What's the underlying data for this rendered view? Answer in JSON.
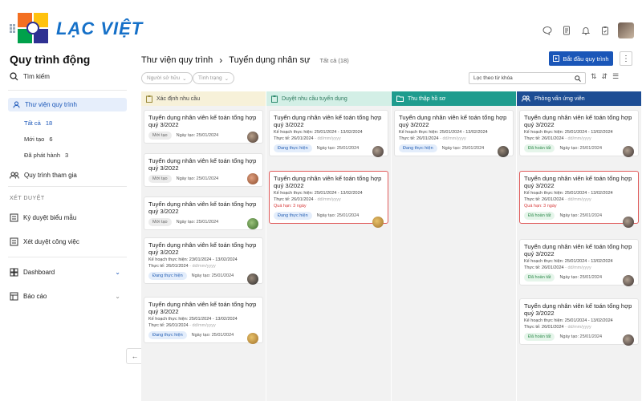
{
  "brand": {
    "name": "LẠC VIỆT"
  },
  "top_icons": [
    "chat-icon",
    "document-icon",
    "bell-icon",
    "clipboard-icon"
  ],
  "sidebar": {
    "title": "Quy trình động",
    "search": "Tìm kiếm",
    "library": "Thư viện quy trình",
    "sub": [
      {
        "label": "Tất cả",
        "count": "18"
      },
      {
        "label": "Mới tạo",
        "count": "6"
      },
      {
        "label": "Đã phát hành",
        "count": "3"
      }
    ],
    "joined": "Quy trình tham gia",
    "section": "XÉT DUYỆT",
    "approve_form": "Ký duyệt biểu mẫu",
    "approve_work": "Xét duyệt công việc",
    "dashboard": "Dashboard",
    "report": "Báo cáo"
  },
  "header": {
    "crumb1": "Thư viện quy trình",
    "sep": "›",
    "crumb2": "Tuyển dụng nhân sự",
    "count": "Tất cả (18)",
    "start_label": "Bắt đầu quy trình",
    "filter_owner": "Người sở hữu",
    "filter_status": "Tình trạng",
    "search_value": "Lọc theo từ khóa"
  },
  "columns": [
    {
      "title": "Xác định nhu cầu",
      "color": "#f7f1d9",
      "accent": "#9a8a3a"
    },
    {
      "title": "Duyệt nhu cầu tuyển dụng",
      "color": "#d3efe6",
      "accent": "#2e8a6e"
    },
    {
      "title": "Thu thập hồ sơ",
      "color": "#1f9c8e",
      "accent": "#ffffff"
    },
    {
      "title": "Phỏng vấn ứng viên",
      "color": "#1d4d94",
      "accent": "#ffffff"
    }
  ],
  "card_text": {
    "title": "Tuyển dụng nhân viên kế toán tổng hợp quý 3/2022",
    "plan_prefix": "Kế hoạch thực hiện:",
    "plan_a": "25/01/2024 - 13/02/2024",
    "plan_b": "23/01/2024 - 13/02/2024",
    "actual_prefix": "Thực tế:",
    "actual_value": "26/01/2024",
    "actual_placeholder": "- dd/mm/yyyy",
    "due": "Quá hạn: 3 ngày",
    "created": "Ngày tạo: 25/01/2024",
    "status_new": "Mới tạo",
    "status_progress": "Đang thực hiện",
    "status_done": "Đã hoàn tất"
  }
}
